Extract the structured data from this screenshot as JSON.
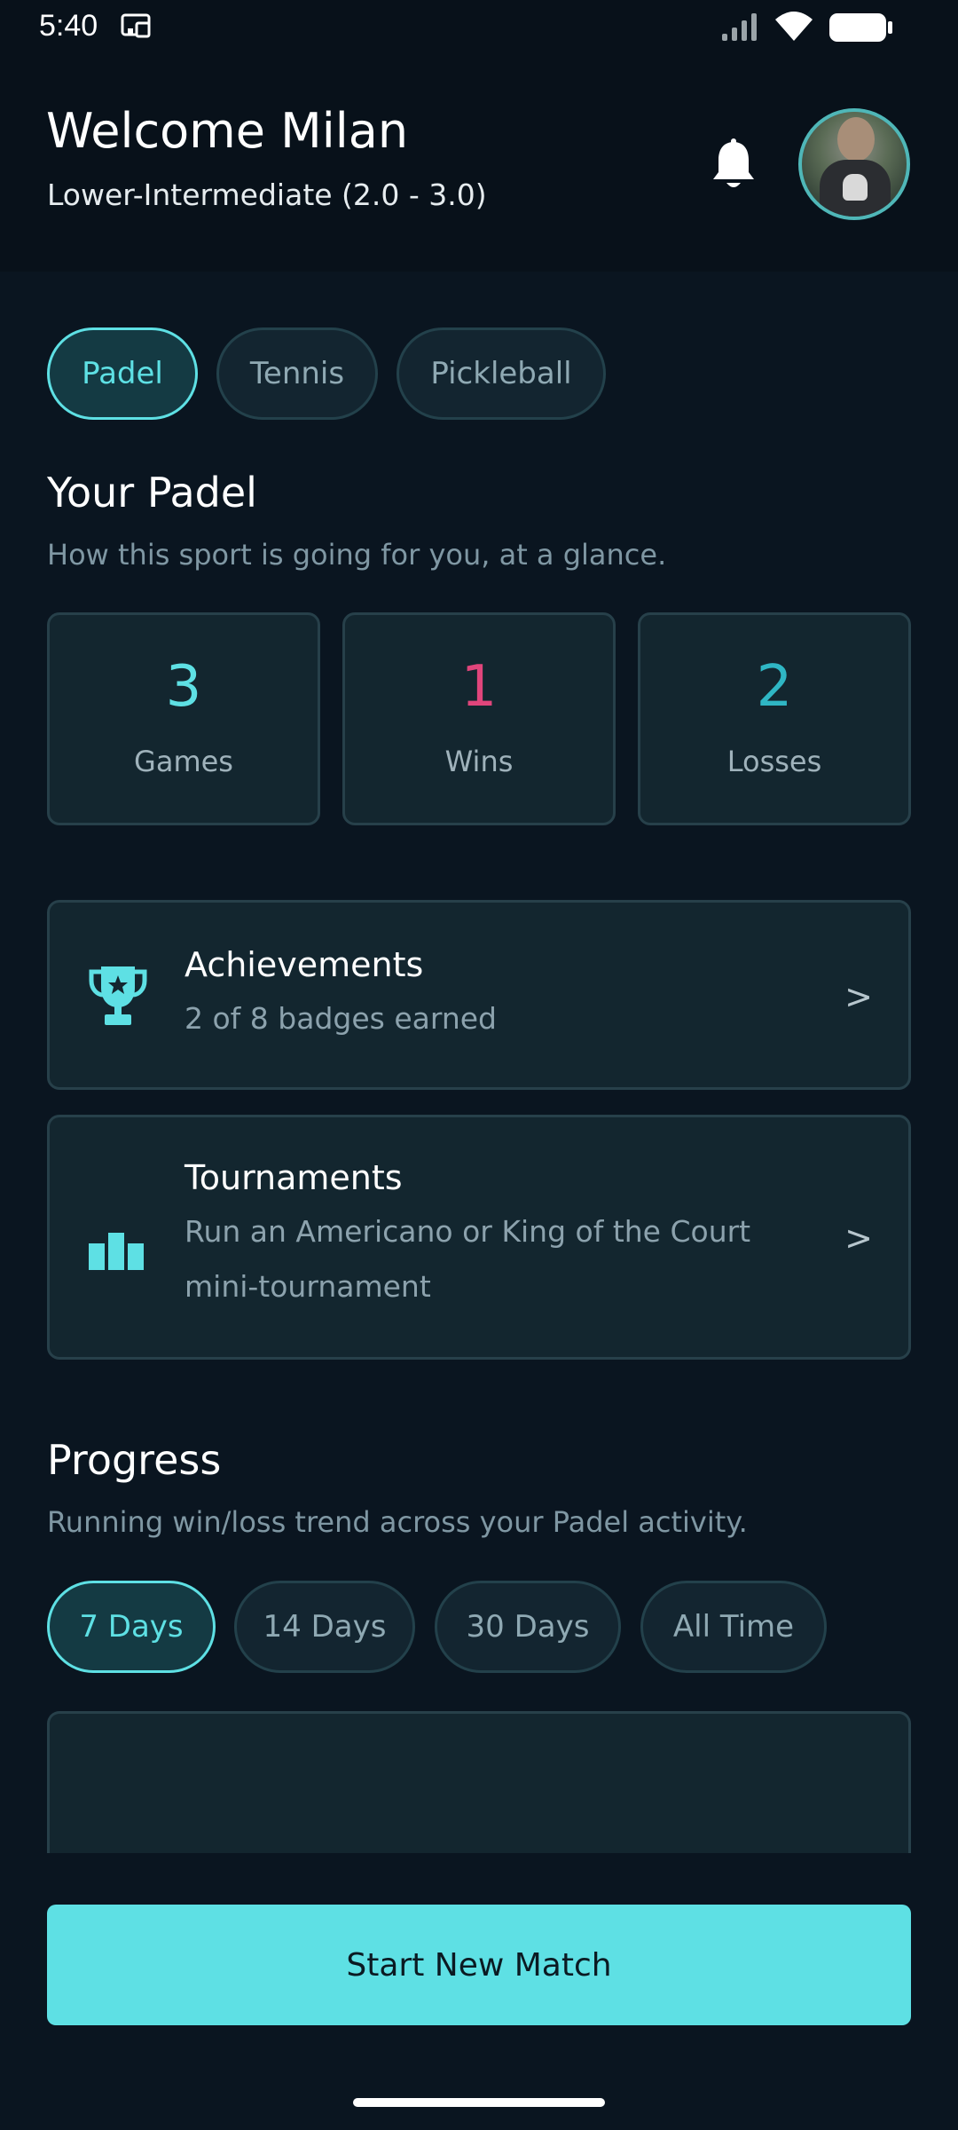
{
  "status_bar": {
    "time": "5:40"
  },
  "header": {
    "welcome": "Welcome Milan",
    "skill_level": "Lower-Intermediate (2.0 - 3.0)"
  },
  "sport_tabs": [
    {
      "label": "Padel",
      "active": true
    },
    {
      "label": "Tennis",
      "active": false
    },
    {
      "label": "Pickleball",
      "active": false
    }
  ],
  "overview": {
    "title": "Your Padel",
    "subtitle": "How this sport is going for you, at a glance."
  },
  "stats": [
    {
      "value": "3",
      "label": "Games",
      "color": "#5ee0e4"
    },
    {
      "value": "1",
      "label": "Wins",
      "color": "#e0457b"
    },
    {
      "value": "2",
      "label": "Losses",
      "color": "#2fb6c4"
    }
  ],
  "achievements": {
    "title": "Achievements",
    "subtitle": "2 of 8 badges earned",
    "chevron": ">",
    "icon": "trophy-icon"
  },
  "tournaments": {
    "title": "Tournaments",
    "subtitle": "Run an Americano or King of the Court mini-tournament",
    "chevron": ">",
    "icon": "bar-chart-icon"
  },
  "progress": {
    "title": "Progress",
    "subtitle": "Running win/loss trend across your Padel activity.",
    "ranges": [
      {
        "label": "7 Days",
        "active": true
      },
      {
        "label": "14 Days",
        "active": false
      },
      {
        "label": "30 Days",
        "active": false
      },
      {
        "label": "All Time",
        "active": false
      }
    ]
  },
  "start_button": {
    "label": "Start New Match"
  },
  "colors": {
    "accent": "#5ee0e4",
    "background": "#0a1520",
    "card": "#13262f",
    "wins": "#e0457b"
  }
}
